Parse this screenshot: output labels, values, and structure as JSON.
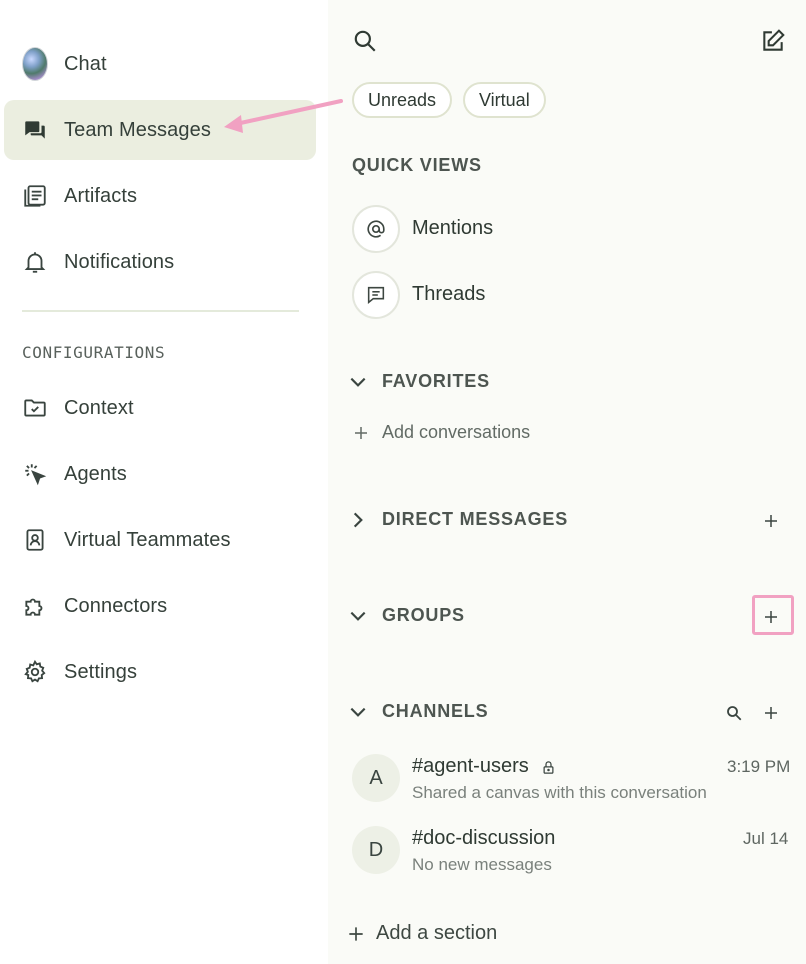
{
  "nav": {
    "items": [
      {
        "label": "Chat",
        "icon": "chat-orb-icon"
      },
      {
        "label": "Team Messages",
        "icon": "team-messages-icon",
        "active": true
      },
      {
        "label": "Artifacts",
        "icon": "artifacts-icon"
      },
      {
        "label": "Notifications",
        "icon": "bell-icon"
      }
    ],
    "config_heading": "CONFIGURATIONS",
    "config_items": [
      {
        "label": "Context",
        "icon": "folder-check-icon"
      },
      {
        "label": "Agents",
        "icon": "cursor-click-icon"
      },
      {
        "label": "Virtual Teammates",
        "icon": "contact-badge-icon"
      },
      {
        "label": "Connectors",
        "icon": "puzzle-icon"
      },
      {
        "label": "Settings",
        "icon": "gear-icon"
      }
    ]
  },
  "panel": {
    "filters": [
      "Unreads",
      "Virtual"
    ],
    "quick_views": {
      "heading": "QUICK VIEWS",
      "items": [
        {
          "label": "Mentions",
          "icon": "at-sign-icon"
        },
        {
          "label": "Threads",
          "icon": "threads-icon"
        }
      ]
    },
    "favorites": {
      "heading": "FAVORITES",
      "add_label": "Add conversations"
    },
    "direct_messages": {
      "heading": "DIRECT MESSAGES"
    },
    "groups": {
      "heading": "GROUPS"
    },
    "channels": {
      "heading": "CHANNELS",
      "items": [
        {
          "initial": "A",
          "name": "#agent-users",
          "subtitle": "Shared a canvas with this conversation",
          "time": "3:19 PM",
          "locked": true
        },
        {
          "initial": "D",
          "name": "#doc-discussion",
          "subtitle": "No new messages",
          "time": "Jul 14",
          "locked": false
        }
      ]
    },
    "add_section_label": "Add a section"
  },
  "colors": {
    "active_nav": "#ebeee0",
    "panel_bg": "#fafbf7",
    "annotation_pink": "#f1a1c2"
  }
}
